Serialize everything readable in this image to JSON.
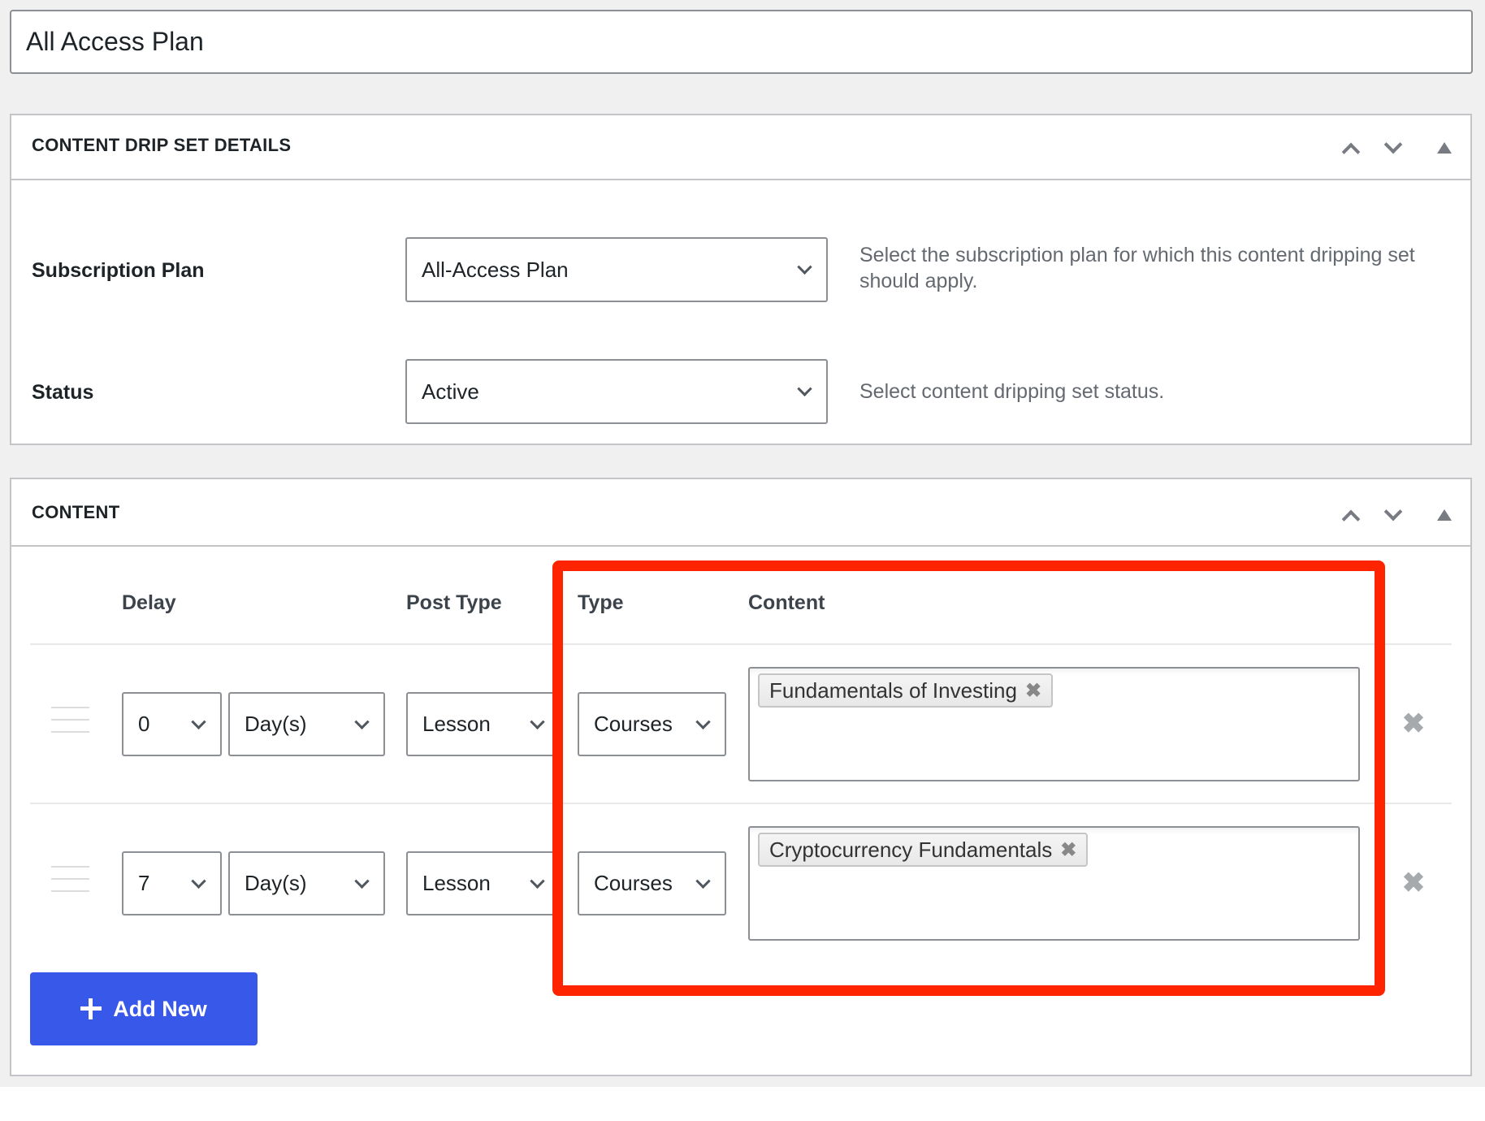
{
  "title_input": {
    "value": "All Access Plan"
  },
  "details_panel": {
    "title": "CONTENT DRIP SET DETAILS",
    "icons": [
      "chevron-up-icon",
      "chevron-down-icon",
      "collapse-triangle-icon"
    ],
    "fields": [
      {
        "label": "Subscription Plan",
        "value": "All-Access Plan",
        "help": "Select the subscription plan for which this content dripping set should apply."
      },
      {
        "label": "Status",
        "value": "Active",
        "help": "Select content dripping set status."
      }
    ]
  },
  "content_panel": {
    "title": "CONTENT",
    "icons": [
      "chevron-up-icon",
      "chevron-down-icon",
      "collapse-triangle-icon"
    ],
    "columns": [
      "Delay",
      "Post Type",
      "Type",
      "Content"
    ],
    "rows": [
      {
        "delay": "0",
        "unit": "Day(s)",
        "post_type": "Lesson",
        "type": "Courses",
        "content": [
          "Fundamentals of Investing"
        ]
      },
      {
        "delay": "7",
        "unit": "Day(s)",
        "post_type": "Lesson",
        "type": "Courses",
        "content": [
          "Cryptocurrency Fundamentals"
        ]
      }
    ],
    "add_button": "Add New",
    "remove_glyph": "✖",
    "tag_remove_glyph": "✖"
  },
  "highlight": {
    "color": "#ff2400",
    "target": "Type and Content columns"
  },
  "colors": {
    "accent": "#3858e9",
    "highlight": "#ff2400",
    "background": "#f0f0f1"
  }
}
